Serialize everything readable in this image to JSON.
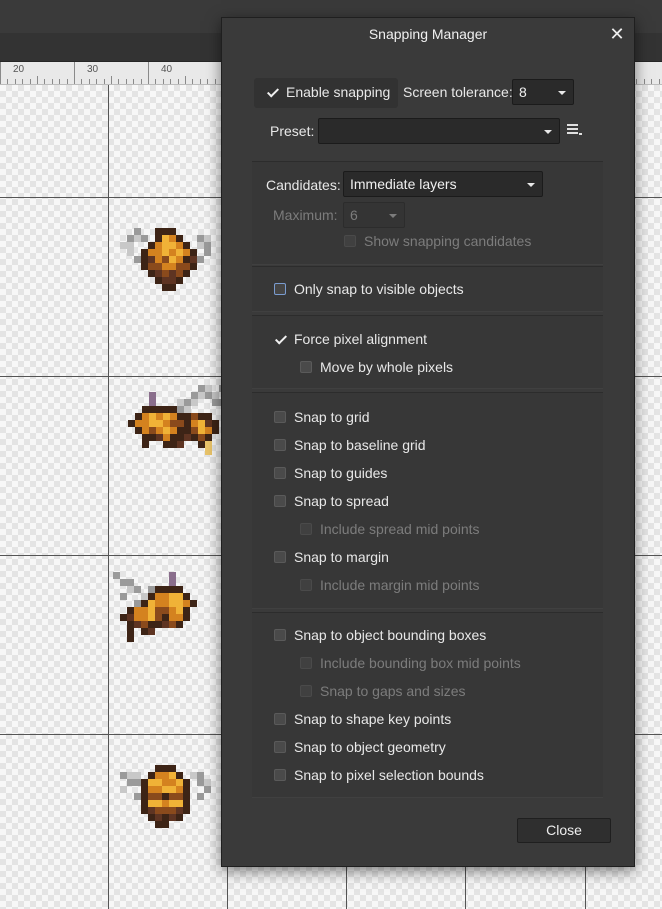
{
  "ruler": {
    "ticks": [
      "20",
      "30",
      "40"
    ]
  },
  "dialog": {
    "title": "Snapping Manager",
    "close_label": "Close",
    "enable_snapping": {
      "label": "Enable snapping",
      "checked": true
    },
    "screen_tolerance": {
      "label": "Screen tolerance:",
      "value": "8"
    },
    "preset": {
      "label": "Preset:",
      "value": ""
    },
    "candidates": {
      "label": "Candidates:",
      "value": "Immediate layers"
    },
    "maximum": {
      "label": "Maximum:",
      "value": "6"
    },
    "show_candidates": {
      "label": "Show snapping candidates",
      "checked": false
    },
    "only_visible": {
      "label": "Only snap to visible objects",
      "checked": false
    },
    "force_pixel": {
      "label": "Force pixel alignment",
      "checked": true
    },
    "move_whole": {
      "label": "Move by whole pixels",
      "checked": false
    },
    "snap_grid": {
      "label": "Snap to grid",
      "checked": false
    },
    "snap_baseline": {
      "label": "Snap to baseline grid",
      "checked": false
    },
    "snap_guides": {
      "label": "Snap to guides",
      "checked": false
    },
    "snap_spread": {
      "label": "Snap to spread",
      "checked": false
    },
    "spread_mid": {
      "label": "Include spread mid points",
      "checked": false
    },
    "snap_margin": {
      "label": "Snap to margin",
      "checked": false
    },
    "margin_mid": {
      "label": "Include margin mid points",
      "checked": false
    },
    "snap_bbox": {
      "label": "Snap to object bounding boxes",
      "checked": false
    },
    "bbox_mid": {
      "label": "Include bounding box mid points",
      "checked": false
    },
    "gaps_sizes": {
      "label": "Snap to gaps and sizes",
      "checked": false
    },
    "shape_key": {
      "label": "Snap to shape key points",
      "checked": false
    },
    "object_geom": {
      "label": "Snap to object geometry",
      "checked": false
    },
    "pixel_sel": {
      "label": "Snap to pixel selection bounds",
      "checked": false
    }
  }
}
